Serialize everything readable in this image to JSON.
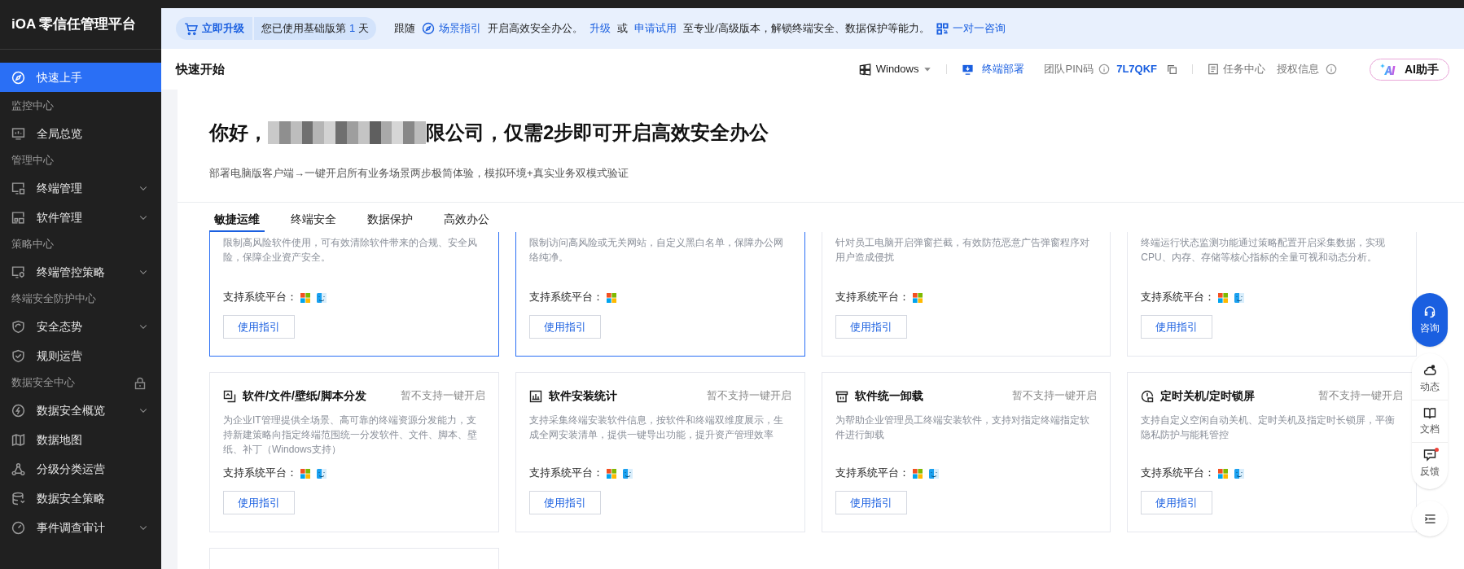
{
  "sidebar": {
    "title": "iOA 零信任管理平台",
    "items": [
      {
        "kind": "item",
        "label": "快速上手",
        "selected": true,
        "expandable": false
      },
      {
        "kind": "section",
        "label": "监控中心",
        "locked": false
      },
      {
        "kind": "item",
        "label": "全局总览",
        "selected": false,
        "expandable": false
      },
      {
        "kind": "section",
        "label": "管理中心",
        "locked": false
      },
      {
        "kind": "item",
        "label": "终端管理",
        "selected": false,
        "expandable": true
      },
      {
        "kind": "item",
        "label": "软件管理",
        "selected": false,
        "expandable": true
      },
      {
        "kind": "section",
        "label": "策略中心",
        "locked": false
      },
      {
        "kind": "item",
        "label": "终端管控策略",
        "selected": false,
        "expandable": true
      },
      {
        "kind": "section",
        "label": "终端安全防护中心",
        "locked": false
      },
      {
        "kind": "item",
        "label": "安全态势",
        "selected": false,
        "expandable": true
      },
      {
        "kind": "item",
        "label": "规则运营",
        "selected": false,
        "expandable": false
      },
      {
        "kind": "section",
        "label": "数据安全中心",
        "locked": true
      },
      {
        "kind": "item",
        "label": "数据安全概览",
        "selected": false,
        "expandable": true
      },
      {
        "kind": "item",
        "label": "数据地图",
        "selected": false,
        "expandable": false
      },
      {
        "kind": "item",
        "label": "分级分类运营",
        "selected": false,
        "expandable": false
      },
      {
        "kind": "item",
        "label": "数据安全策略",
        "selected": false,
        "expandable": false
      },
      {
        "kind": "item",
        "label": "事件调查审计",
        "selected": false,
        "expandable": true
      }
    ]
  },
  "banner": {
    "upgrade_button": "立即升级",
    "trial_badge": {
      "prefix": "您已使用基础版第",
      "days": "1",
      "suffix": "天"
    },
    "parts": [
      {
        "kind": "text",
        "text": "跟随"
      },
      {
        "kind": "icon_link",
        "text": "场景指引"
      },
      {
        "kind": "text",
        "text": "开启高效安全办公。"
      },
      {
        "kind": "link",
        "text": "升级"
      },
      {
        "kind": "text",
        "text": "或"
      },
      {
        "kind": "link",
        "text": "申请试用"
      },
      {
        "kind": "text",
        "text": "至专业/高级版本，解锁终端安全、数据保护等能力。"
      },
      {
        "kind": "qr_link",
        "text": "一对一咨询"
      }
    ]
  },
  "header": {
    "title": "快速开始",
    "os_select": "Windows",
    "deploy_link": "终端部署",
    "pin_label": "团队PIN码",
    "pin_code": "7L7QKF",
    "task_center": "任务中心",
    "license_info": "授权信息",
    "ai_button": "AI助手"
  },
  "hero": {
    "greeting_prefix": "你好，",
    "greeting_suffix": "限公司，仅需2步即可开启高效安全办公",
    "subtitle": "部署电脑版客户端→一键开启所有业务场景两步极简体验，模拟环境+真实业务双模式验证"
  },
  "tabs": [
    {
      "label": "敏捷运维",
      "selected": true
    },
    {
      "label": "终端安全",
      "selected": false
    },
    {
      "label": "数据保护",
      "selected": false
    },
    {
      "label": "高效办公",
      "selected": false
    }
  ],
  "cards": [
    {
      "kind": "clipped",
      "highlighted": true,
      "description": "限制高风险软件使用，可有效清除软件带来的合规、安全风险，保障企业资产安全。",
      "platform_label": "支持系统平台：",
      "platforms": [
        {
          "kind": "windows"
        },
        {
          "kind": "mac"
        }
      ],
      "button": "使用指引"
    },
    {
      "kind": "clipped",
      "highlighted": true,
      "description": "限制访问高风险或无关网站，自定义黑白名单，保障办公网络纯净。",
      "platform_label": "支持系统平台：",
      "platforms": [
        {
          "kind": "windows"
        }
      ],
      "button": "使用指引"
    },
    {
      "kind": "clipped",
      "highlighted": false,
      "description": "针对员工电脑开启弹窗拦截，有效防范恶意广告弹窗程序对用户造成侵扰",
      "platform_label": "支持系统平台：",
      "platforms": [
        {
          "kind": "windows"
        }
      ],
      "button": "使用指引"
    },
    {
      "kind": "clipped",
      "highlighted": false,
      "description": "终端运行状态监测功能通过策略配置开启采集数据，实现CPU、内存、存储等核心指标的全量可视和动态分析。",
      "platform_label": "支持系统平台：",
      "platforms": [
        {
          "kind": "windows"
        },
        {
          "kind": "mac"
        }
      ],
      "button": "使用指引"
    },
    {
      "kind": "full",
      "highlighted": false,
      "title": "软件/文件/壁纸/脚本分发",
      "status": "暂不支持一键开启",
      "description": "为企业IT管理提供全场景、高可靠的终端资源分发能力，支持新建策略向指定终端范围统一分发软件、文件、脚本、壁纸、补丁（Windows支持）",
      "platform_label": "支持系统平台：",
      "platforms": [
        {
          "kind": "windows"
        },
        {
          "kind": "mac"
        }
      ],
      "button": "使用指引"
    },
    {
      "kind": "full",
      "highlighted": false,
      "title": "软件安装统计",
      "status": "暂不支持一键开启",
      "description": "支持采集终端安装软件信息，按软件和终端双维度展示，生成全网安装清单，提供一键导出功能，提升资产管理效率",
      "platform_label": "支持系统平台：",
      "platforms": [
        {
          "kind": "windows"
        },
        {
          "kind": "mac"
        }
      ],
      "button": "使用指引"
    },
    {
      "kind": "full",
      "highlighted": false,
      "title": "软件统一卸载",
      "status": "暂不支持一键开启",
      "description": "为帮助企业管理员工终端安装软件，支持对指定终端指定软件进行卸载",
      "platform_label": "支持系统平台：",
      "platforms": [
        {
          "kind": "windows"
        },
        {
          "kind": "mac"
        }
      ],
      "button": "使用指引"
    },
    {
      "kind": "full",
      "highlighted": false,
      "title": "定时关机/定时锁屏",
      "status": "暂不支持一键开启",
      "description": "支持自定义空闲自动关机、定时关机及指定时长锁屏，平衡隐私防护与能耗管控",
      "platform_label": "支持系统平台：",
      "platforms": [
        {
          "kind": "windows"
        },
        {
          "kind": "mac"
        }
      ],
      "button": "使用指引"
    },
    {
      "kind": "peek",
      "highlighted": false
    }
  ],
  "float_toolbar": {
    "consult": "咨询",
    "items": [
      {
        "label": "动态",
        "badge": false
      },
      {
        "label": "文档",
        "badge": false
      },
      {
        "label": "反馈",
        "badge": true
      }
    ]
  }
}
